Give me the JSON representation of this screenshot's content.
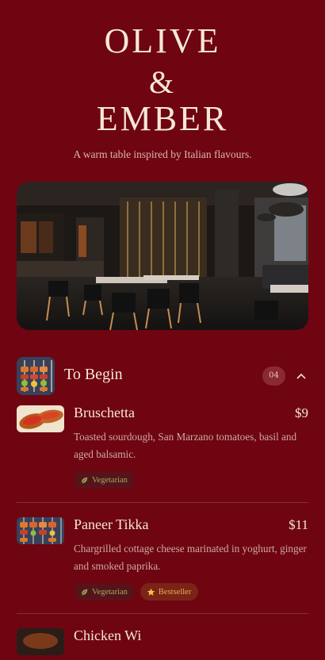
{
  "brand": {
    "line1": "OLIVE",
    "line2": "&",
    "line3": "EMBER"
  },
  "tagline": "A warm table inspired by Italian flavours.",
  "section": {
    "title": "To Begin",
    "count": "04",
    "expanded": true
  },
  "items": [
    {
      "name": "Bruschetta",
      "price": "$9",
      "description": "Toasted sourdough, San Marzano tomatoes, basil and aged balsamic.",
      "tags": [
        "Vegetarian"
      ]
    },
    {
      "name": "Paneer Tikka",
      "price": "$11",
      "description": "Chargrilled cottage cheese marinated in yoghurt, ginger and smoked paprika.",
      "tags": [
        "Vegetarian",
        "Bestseller"
      ]
    },
    {
      "name": "Chicken Wi",
      "price": "",
      "description": "",
      "tags": []
    }
  ],
  "colors": {
    "background": "#6e0510",
    "vegetarian": "#8fb25c",
    "bestseller": "#f2a65a"
  },
  "icons": {
    "collapse": "chevron-up-icon",
    "vegetarian": "leaf-icon",
    "bestseller": "star-icon"
  }
}
